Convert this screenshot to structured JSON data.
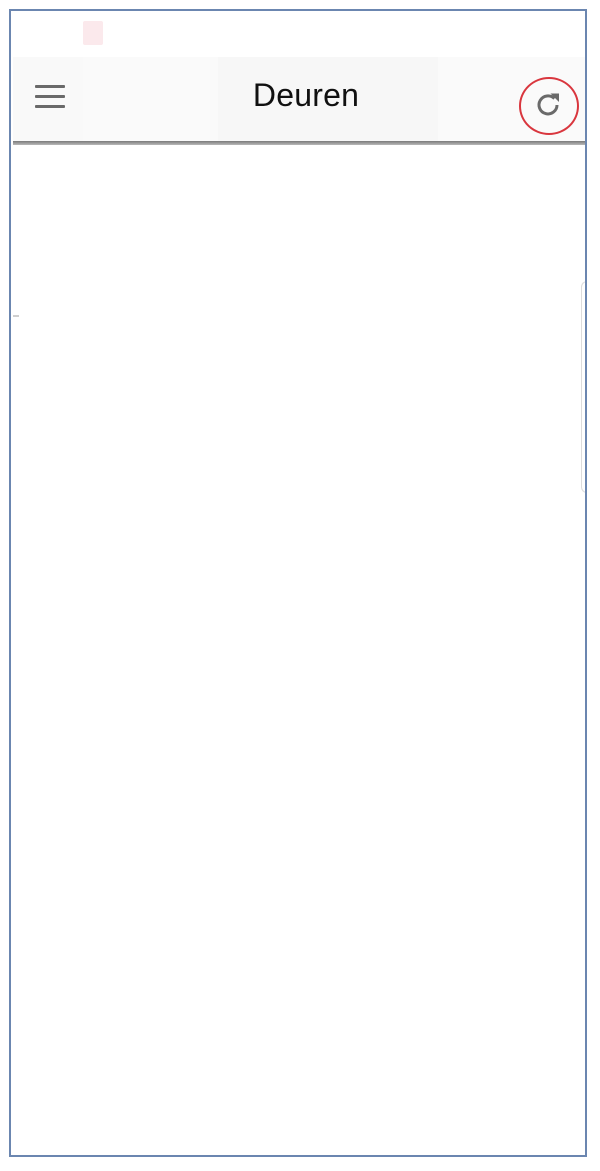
{
  "app_bar": {
    "title": "Deuren",
    "menu_icon": "hamburger-menu-icon",
    "refresh_icon": "refresh-icon"
  },
  "colors": {
    "frame_border": "#6b86b0",
    "highlight_ring": "#d9363e",
    "icon_gray": "#6a6a6a",
    "app_bar_background": "#f9f9f9"
  }
}
